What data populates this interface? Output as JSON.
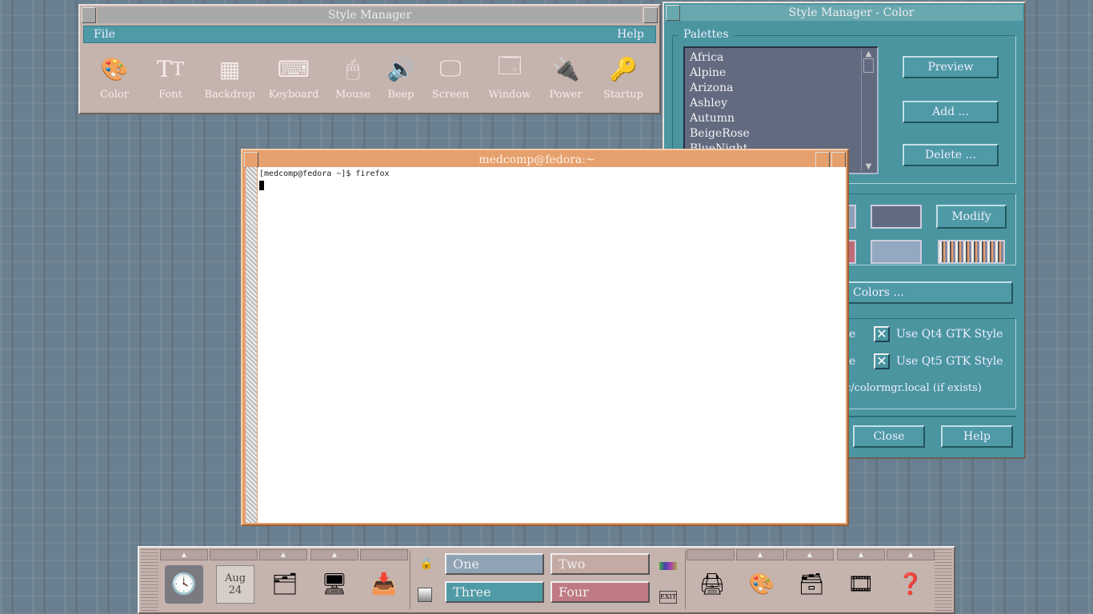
{
  "style_manager": {
    "title": "Style Manager",
    "menu": {
      "file": "File",
      "help": "Help"
    },
    "tools": [
      {
        "label": "Color",
        "icon": "palette-icon"
      },
      {
        "label": "Font",
        "icon": "font-icon"
      },
      {
        "label": "Backdrop",
        "icon": "backdrop-icon"
      },
      {
        "label": "Keyboard",
        "icon": "keyboard-icon"
      },
      {
        "label": "Mouse",
        "icon": "mouse-icon"
      },
      {
        "label": "Beep",
        "icon": "speaker-icon"
      },
      {
        "label": "Screen",
        "icon": "screen-icon"
      },
      {
        "label": "Window",
        "icon": "window-icon"
      },
      {
        "label": "Power",
        "icon": "power-plug-icon"
      },
      {
        "label": "Startup",
        "icon": "key-icon"
      }
    ]
  },
  "color_manager": {
    "title": "Style Manager - Color",
    "palettes_label": "Palettes",
    "palettes": [
      "Africa",
      "Alpine",
      "Arizona",
      "Ashley",
      "Autumn",
      "BeigeRose",
      "BlueNight"
    ],
    "buttons": {
      "preview": "Preview",
      "add": "Add ...",
      "delete": "Delete ...",
      "modify": "Modify",
      "colors": "Colors ...",
      "close": "Close",
      "help": "Help"
    },
    "options": {
      "qt4_partial": "ne",
      "qt4": "Use Qt4 GTK Style",
      "qt5_partial": "ne",
      "qt5": "Use Qt5 GTK Style",
      "colormgr": "c/colormgr.local (if exists)"
    },
    "swatches": [
      "#8fa0b8",
      "#626a80",
      "#c06a78",
      "#94a8c0"
    ]
  },
  "terminal": {
    "title": "medcomp@fedora:~",
    "line": "[medcomp@fedora ~]$ firefox"
  },
  "panel": {
    "date_month": "Aug",
    "date_day": "24",
    "workspaces": [
      {
        "label": "One",
        "color": "#8fa3b5"
      },
      {
        "label": "Two",
        "color": "#c4aaa4"
      },
      {
        "label": "Three",
        "color": "#4e9aa6"
      },
      {
        "label": "Four",
        "color": "#c07a84"
      }
    ],
    "exit_label": "EXIT"
  }
}
